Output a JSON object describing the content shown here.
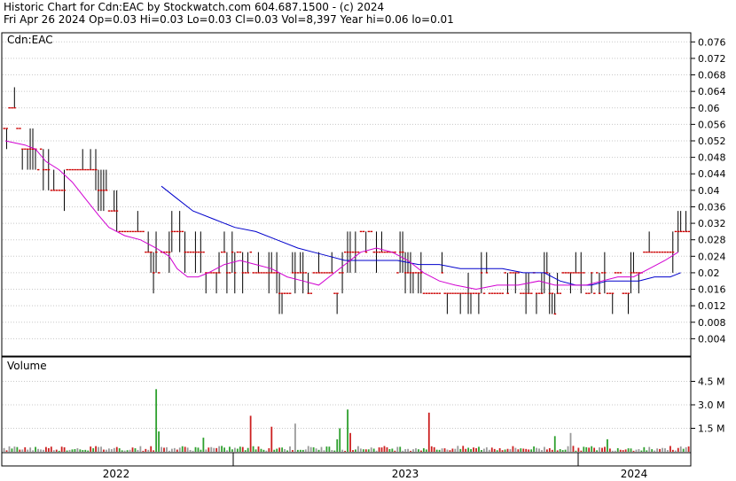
{
  "header": {
    "line1": "Historic Chart for Cdn:EAC by Stockwatch.com 604.687.1500 - (c) 2024",
    "line2": "Fri Apr 26 2024   Op=0.03   Hi=0.03   Lo=0.03   Cl=0.03   Vol=8,397   Year hi=0.06   lo=0.01"
  },
  "chart_data": [
    {
      "type": "ohlc-bar",
      "title": "Cdn:EAC",
      "ylim": [
        0.0,
        0.078
      ],
      "y_ticks": [
        "0.076",
        "0.072",
        "0.068",
        "0.064",
        "0.06",
        "0.056",
        "0.052",
        "0.048",
        "0.044",
        "0.04",
        "0.036",
        "0.032",
        "0.028",
        "0.024",
        "0.02",
        "0.016",
        "0.012",
        "0.008",
        "0.004"
      ],
      "x_period_labels": [
        "2022",
        "2023",
        "2024"
      ],
      "price_path": [
        [
          0,
          0.055
        ],
        [
          4,
          0.06
        ],
        [
          8,
          0.05
        ],
        [
          14,
          0.047
        ],
        [
          20,
          0.04
        ],
        [
          26,
          0.045
        ],
        [
          30,
          0.044
        ],
        [
          34,
          0.046
        ],
        [
          40,
          0.036
        ],
        [
          46,
          0.032
        ],
        [
          52,
          0.029
        ],
        [
          58,
          0.022
        ],
        [
          62,
          0.027
        ],
        [
          66,
          0.03
        ],
        [
          72,
          0.026
        ],
        [
          78,
          0.021
        ],
        [
          84,
          0.022
        ],
        [
          90,
          0.024
        ],
        [
          96,
          0.02
        ],
        [
          100,
          0.022
        ],
        [
          106,
          0.016
        ],
        [
          112,
          0.02
        ],
        [
          118,
          0.018
        ],
        [
          124,
          0.019
        ],
        [
          127,
          0.016
        ],
        [
          132,
          0.026
        ],
        [
          138,
          0.028
        ],
        [
          142,
          0.025
        ],
        [
          146,
          0.023
        ],
        [
          152,
          0.024
        ],
        [
          156,
          0.02
        ],
        [
          162,
          0.016
        ],
        [
          168,
          0.017
        ],
        [
          174,
          0.016
        ],
        [
          180,
          0.017
        ],
        [
          188,
          0.016
        ],
        [
          194,
          0.018
        ],
        [
          200,
          0.016
        ],
        [
          206,
          0.018
        ],
        [
          210,
          0.013
        ],
        [
          214,
          0.02
        ],
        [
          220,
          0.018
        ],
        [
          226,
          0.017
        ],
        [
          232,
          0.018
        ],
        [
          238,
          0.016
        ],
        [
          244,
          0.022
        ],
        [
          248,
          0.026
        ],
        [
          252,
          0.024
        ],
        [
          256,
          0.028
        ],
        [
          260,
          0.029
        ]
      ],
      "ma_fast": [
        [
          0.5,
          0.052
        ],
        [
          8,
          0.051
        ],
        [
          12,
          0.05
        ],
        [
          16,
          0.047
        ],
        [
          21,
          0.045
        ],
        [
          26,
          0.042
        ],
        [
          31,
          0.038
        ],
        [
          36,
          0.034
        ],
        [
          40,
          0.031
        ],
        [
          46,
          0.029
        ],
        [
          52,
          0.028
        ],
        [
          58,
          0.026
        ],
        [
          63,
          0.024
        ],
        [
          66,
          0.021
        ],
        [
          70,
          0.019
        ],
        [
          74,
          0.019
        ],
        [
          78,
          0.02
        ],
        [
          84,
          0.022
        ],
        [
          90,
          0.023
        ],
        [
          96,
          0.022
        ],
        [
          102,
          0.021
        ],
        [
          108,
          0.019
        ],
        [
          114,
          0.018
        ],
        [
          120,
          0.017
        ],
        [
          126,
          0.02
        ],
        [
          130,
          0.022
        ],
        [
          136,
          0.025
        ],
        [
          142,
          0.026
        ],
        [
          148,
          0.025
        ],
        [
          154,
          0.023
        ],
        [
          160,
          0.02
        ],
        [
          166,
          0.018
        ],
        [
          172,
          0.017
        ],
        [
          180,
          0.016
        ],
        [
          188,
          0.017
        ],
        [
          196,
          0.017
        ],
        [
          204,
          0.018
        ],
        [
          210,
          0.017
        ],
        [
          216,
          0.017
        ],
        [
          222,
          0.017
        ],
        [
          228,
          0.018
        ],
        [
          234,
          0.019
        ],
        [
          240,
          0.019
        ],
        [
          246,
          0.021
        ],
        [
          252,
          0.023
        ],
        [
          257,
          0.025
        ]
      ],
      "ma_slow": [
        [
          60,
          0.041
        ],
        [
          66,
          0.038
        ],
        [
          72,
          0.035
        ],
        [
          80,
          0.033
        ],
        [
          88,
          0.031
        ],
        [
          96,
          0.03
        ],
        [
          104,
          0.028
        ],
        [
          112,
          0.026
        ],
        [
          118,
          0.025
        ],
        [
          124,
          0.024
        ],
        [
          130,
          0.023
        ],
        [
          136,
          0.023
        ],
        [
          142,
          0.023
        ],
        [
          150,
          0.023
        ],
        [
          158,
          0.022
        ],
        [
          166,
          0.022
        ],
        [
          174,
          0.021
        ],
        [
          182,
          0.021
        ],
        [
          190,
          0.021
        ],
        [
          198,
          0.02
        ],
        [
          206,
          0.02
        ],
        [
          212,
          0.018
        ],
        [
          218,
          0.017
        ],
        [
          224,
          0.017
        ],
        [
          230,
          0.018
        ],
        [
          236,
          0.018
        ],
        [
          242,
          0.018
        ],
        [
          248,
          0.019
        ],
        [
          254,
          0.019
        ],
        [
          258,
          0.02
        ]
      ]
    },
    {
      "type": "bar",
      "title": "Volume",
      "ylim": [
        0,
        6000000
      ],
      "y_ticks": [
        "4.5 M",
        "3.0 M",
        "1.5 M"
      ],
      "spikes": [
        [
          58,
          4000000,
          "up"
        ],
        [
          59,
          1300000,
          "up"
        ],
        [
          76,
          900000,
          "up"
        ],
        [
          94,
          2300000,
          "down"
        ],
        [
          102,
          1600000,
          "down"
        ],
        [
          111,
          1800000,
          "neutral"
        ],
        [
          127,
          800000,
          "up"
        ],
        [
          128,
          1500000,
          "up"
        ],
        [
          131,
          2700000,
          "up"
        ],
        [
          132,
          1200000,
          "down"
        ],
        [
          162,
          2500000,
          "down"
        ],
        [
          210,
          1000000,
          "up"
        ],
        [
          216,
          1200000,
          "neutral"
        ],
        [
          230,
          800000,
          "up"
        ]
      ]
    }
  ]
}
